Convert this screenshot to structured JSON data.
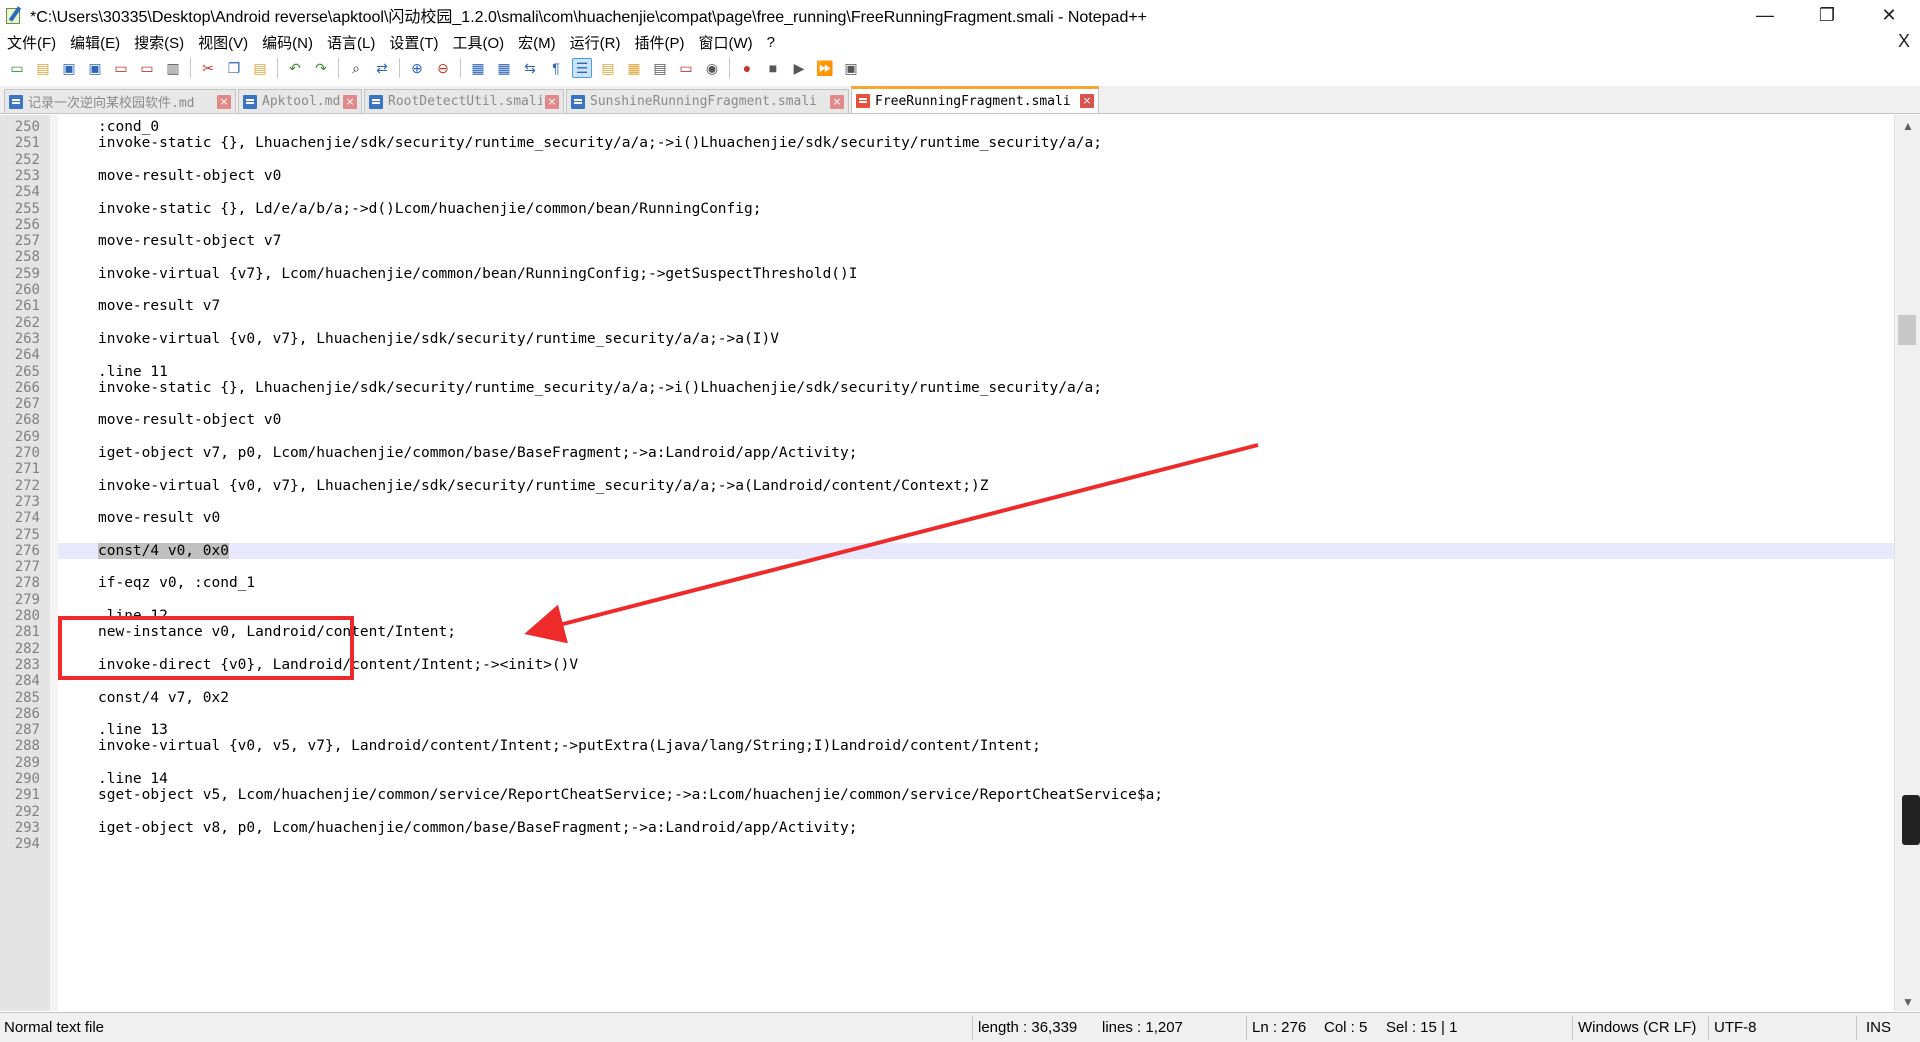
{
  "window": {
    "title": "*C:\\Users\\30335\\Desktop\\Android reverse\\apktool\\闪动校园_1.2.0\\smali\\com\\huachenjie\\compat\\page\\free_running\\FreeRunningFragment.smali - Notepad++",
    "minimize": "—",
    "restore": "❐",
    "close": "✕",
    "doc_close": "X"
  },
  "menu": [
    "文件(F)",
    "编辑(E)",
    "搜索(S)",
    "视图(V)",
    "编码(N)",
    "语言(L)",
    "设置(T)",
    "工具(O)",
    "宏(M)",
    "运行(R)",
    "插件(P)",
    "窗口(W)",
    "?"
  ],
  "toolbar": [
    {
      "name": "new-file-icon",
      "glyph": "▭",
      "color": "#3b8f3b"
    },
    {
      "name": "open-file-icon",
      "glyph": "▤",
      "color": "#e0a63a"
    },
    {
      "name": "save-icon",
      "glyph": "▣",
      "color": "#2f65b8"
    },
    {
      "name": "save-all-icon",
      "glyph": "▣",
      "color": "#2f65b8"
    },
    {
      "name": "close-file-icon",
      "glyph": "▭",
      "color": "#c0392b"
    },
    {
      "name": "close-all-icon",
      "glyph": "▭",
      "color": "#c0392b"
    },
    {
      "name": "print-icon",
      "glyph": "▥",
      "color": "#555555"
    },
    {
      "name": "sep"
    },
    {
      "name": "cut-icon",
      "glyph": "✂",
      "color": "#c0392b"
    },
    {
      "name": "copy-icon",
      "glyph": "❐",
      "color": "#2f65b8"
    },
    {
      "name": "paste-icon",
      "glyph": "▤",
      "color": "#e0a63a"
    },
    {
      "name": "sep"
    },
    {
      "name": "undo-icon",
      "glyph": "↶",
      "color": "#3b8f3b"
    },
    {
      "name": "redo-icon",
      "glyph": "↷",
      "color": "#3b8f3b"
    },
    {
      "name": "sep"
    },
    {
      "name": "find-icon",
      "glyph": "⌕",
      "color": "#333333"
    },
    {
      "name": "replace-icon",
      "glyph": "⇄",
      "color": "#2f65b8"
    },
    {
      "name": "sep"
    },
    {
      "name": "zoom-in-icon",
      "glyph": "⊕",
      "color": "#2f65b8"
    },
    {
      "name": "zoom-out-icon",
      "glyph": "⊖",
      "color": "#c0392b"
    },
    {
      "name": "sep"
    },
    {
      "name": "sync-vertical-icon",
      "glyph": "▦",
      "color": "#2f65b8"
    },
    {
      "name": "sync-horizontal-icon",
      "glyph": "▦",
      "color": "#2f65b8"
    },
    {
      "name": "word-wrap-icon",
      "glyph": "⇆",
      "color": "#2f65b8"
    },
    {
      "name": "show-all-chars-icon",
      "glyph": "¶",
      "color": "#2f65b8"
    },
    {
      "name": "indent-guide-icon",
      "glyph": "☰",
      "color": "#2f65b8",
      "active": true
    },
    {
      "name": "udl-icon",
      "glyph": "▤",
      "color": "#e0a63a"
    },
    {
      "name": "doc-map-icon",
      "glyph": "▦",
      "color": "#e0a63a"
    },
    {
      "name": "function-list-icon",
      "glyph": "▤",
      "color": "#555555"
    },
    {
      "name": "folder-workspace-icon",
      "glyph": "▭",
      "color": "#c0392b"
    },
    {
      "name": "monitoring-icon",
      "glyph": "◉",
      "color": "#555555"
    },
    {
      "name": "sep"
    },
    {
      "name": "record-macro-icon",
      "glyph": "●",
      "color": "#c0392b"
    },
    {
      "name": "stop-record-icon",
      "glyph": "■",
      "color": "#555555"
    },
    {
      "name": "playback-macro-icon",
      "glyph": "▶",
      "color": "#555555"
    },
    {
      "name": "run-macro-multiple-icon",
      "glyph": "⏩",
      "color": "#2f65b8"
    },
    {
      "name": "save-macro-icon",
      "glyph": "▣",
      "color": "#555555"
    }
  ],
  "tabs": [
    {
      "label": "记录一次逆向某校园软件.md",
      "active": false,
      "width": 232
    },
    {
      "label": "Apktool.md",
      "active": false,
      "width": 124
    },
    {
      "label": "RootDetectUtil.smali",
      "active": false,
      "width": 200
    },
    {
      "label": "SunshineRunningFragment.smali",
      "active": false,
      "width": 283
    },
    {
      "label": "FreeRunningFragment.smali",
      "active": true,
      "width": 248
    }
  ],
  "editor": {
    "current_line": 276,
    "selection_text": "const/4 v0, 0x0",
    "lines": [
      {
        "n": "250",
        "t": ":cond_0"
      },
      {
        "n": "251",
        "t": "invoke-static {}, Lhuachenjie/sdk/security/runtime_security/a/a;->i()Lhuachenjie/sdk/security/runtime_security/a/a;"
      },
      {
        "n": "252",
        "t": ""
      },
      {
        "n": "253",
        "t": "move-result-object v0"
      },
      {
        "n": "254",
        "t": ""
      },
      {
        "n": "255",
        "t": "invoke-static {}, Ld/e/a/b/a;->d()Lcom/huachenjie/common/bean/RunningConfig;"
      },
      {
        "n": "256",
        "t": ""
      },
      {
        "n": "257",
        "t": "move-result-object v7"
      },
      {
        "n": "258",
        "t": ""
      },
      {
        "n": "259",
        "t": "invoke-virtual {v7}, Lcom/huachenjie/common/bean/RunningConfig;->getSuspectThreshold()I"
      },
      {
        "n": "260",
        "t": ""
      },
      {
        "n": "261",
        "t": "move-result v7"
      },
      {
        "n": "262",
        "t": ""
      },
      {
        "n": "263",
        "t": "invoke-virtual {v0, v7}, Lhuachenjie/sdk/security/runtime_security/a/a;->a(I)V"
      },
      {
        "n": "264",
        "t": ""
      },
      {
        "n": "265",
        "t": ".line 11"
      },
      {
        "n": "266",
        "t": "invoke-static {}, Lhuachenjie/sdk/security/runtime_security/a/a;->i()Lhuachenjie/sdk/security/runtime_security/a/a;"
      },
      {
        "n": "267",
        "t": ""
      },
      {
        "n": "268",
        "t": "move-result-object v0"
      },
      {
        "n": "269",
        "t": ""
      },
      {
        "n": "270",
        "t": "iget-object v7, p0, Lcom/huachenjie/common/base/BaseFragment;->a:Landroid/app/Activity;"
      },
      {
        "n": "271",
        "t": ""
      },
      {
        "n": "272",
        "t": "invoke-virtual {v0, v7}, Lhuachenjie/sdk/security/runtime_security/a/a;->a(Landroid/content/Context;)Z"
      },
      {
        "n": "273",
        "t": ""
      },
      {
        "n": "274",
        "t": "move-result v0"
      },
      {
        "n": "275",
        "t": ""
      },
      {
        "n": "276",
        "t": "const/4 v0, 0x0"
      },
      {
        "n": "277",
        "t": ""
      },
      {
        "n": "278",
        "t": "if-eqz v0, :cond_1"
      },
      {
        "n": "279",
        "t": ""
      },
      {
        "n": "280",
        "t": ".line 12"
      },
      {
        "n": "281",
        "t": "new-instance v0, Landroid/content/Intent;"
      },
      {
        "n": "282",
        "t": ""
      },
      {
        "n": "283",
        "t": "invoke-direct {v0}, Landroid/content/Intent;-><init>()V"
      },
      {
        "n": "284",
        "t": ""
      },
      {
        "n": "285",
        "t": "const/4 v7, 0x2"
      },
      {
        "n": "286",
        "t": ""
      },
      {
        "n": "287",
        "t": ".line 13"
      },
      {
        "n": "288",
        "t": "invoke-virtual {v0, v5, v7}, Landroid/content/Intent;->putExtra(Ljava/lang/String;I)Landroid/content/Intent;"
      },
      {
        "n": "289",
        "t": ""
      },
      {
        "n": "290",
        "t": ".line 14"
      },
      {
        "n": "291",
        "t": "sget-object v5, Lcom/huachenjie/common/service/ReportCheatService;->a:Lcom/huachenjie/common/service/ReportCheatService$a;"
      },
      {
        "n": "292",
        "t": ""
      },
      {
        "n": "293",
        "t": "iget-object v8, p0, Lcom/huachenjie/common/base/BaseFragment;->a:Landroid/app/Activity;"
      },
      {
        "n": "294",
        "t": ""
      }
    ]
  },
  "scrollbar": {
    "up": "▲",
    "down": "▼"
  },
  "status": {
    "file_type": "Normal text file",
    "length": "length : 36,339",
    "lines": "lines : 1,207",
    "ln": "Ln : 276",
    "col": "Col : 5",
    "sel": "Sel : 15 | 1",
    "eol": "Windows (CR LF)",
    "encoding": "UTF-8",
    "mode": "INS"
  },
  "annotation": {
    "color": "#ee2a2a"
  }
}
